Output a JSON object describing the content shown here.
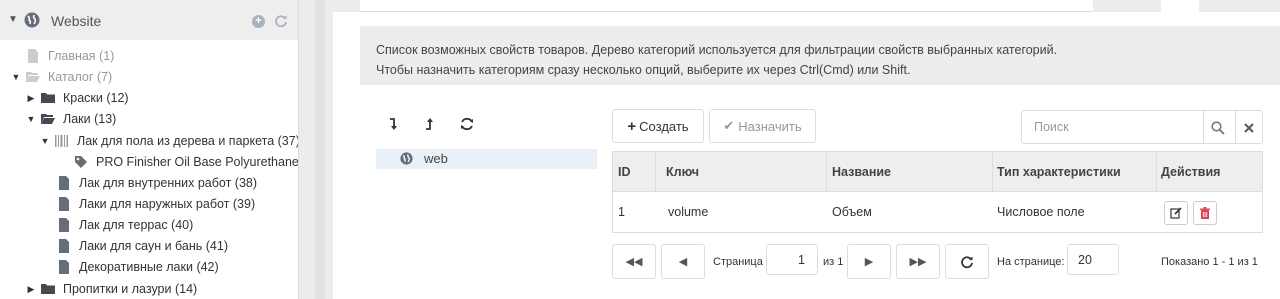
{
  "sidebar": {
    "site_label": "Website",
    "items": [
      {
        "label": "Главная (1)"
      },
      {
        "label": "Каталог (7)"
      },
      {
        "label": "Краски (12)"
      },
      {
        "label": "Лаки (13)"
      },
      {
        "label": "Лак для пола из дерева и паркета (37)"
      },
      {
        "label": "PRO Finisher Oil Base Polyurethane"
      },
      {
        "label": "Лак для внутренних работ (38)"
      },
      {
        "label": "Лаки для наружных работ (39)"
      },
      {
        "label": "Лак для террас (40)"
      },
      {
        "label": "Лаки для саун и бань (41)"
      },
      {
        "label": "Декоративные лаки (42)"
      },
      {
        "label": "Пропитки и лазури (14)"
      }
    ]
  },
  "info": {
    "line1": "Список возможных свойств товаров. Дерево категорий используется для фильтрации свойств выбранных категорий.",
    "line2": "Чтобы назначить категориям сразу несколько опций, выберите их через Ctrl(Cmd) или Shift."
  },
  "category_tree": {
    "root_label": "web"
  },
  "toolbar": {
    "create_label": "Создать",
    "assign_label": "Назначить",
    "search_placeholder": "Поиск"
  },
  "table": {
    "columns": [
      "ID",
      "Ключ",
      "Название",
      "Тип характеристики",
      "Действия"
    ],
    "rows": [
      {
        "id": "1",
        "key": "volume",
        "name": "Объем",
        "type": "Числовое поле"
      }
    ]
  },
  "pager": {
    "page_label": "Страница",
    "page_value": "1",
    "of_label": "из 1",
    "per_page_label": "На странице:",
    "per_page_value": "20",
    "shown_label": "Показано 1 - 1 из 1"
  },
  "colors": {
    "accent": "#4a89dc",
    "icon_gray": "#656d78",
    "delete_red": "#da4453"
  }
}
